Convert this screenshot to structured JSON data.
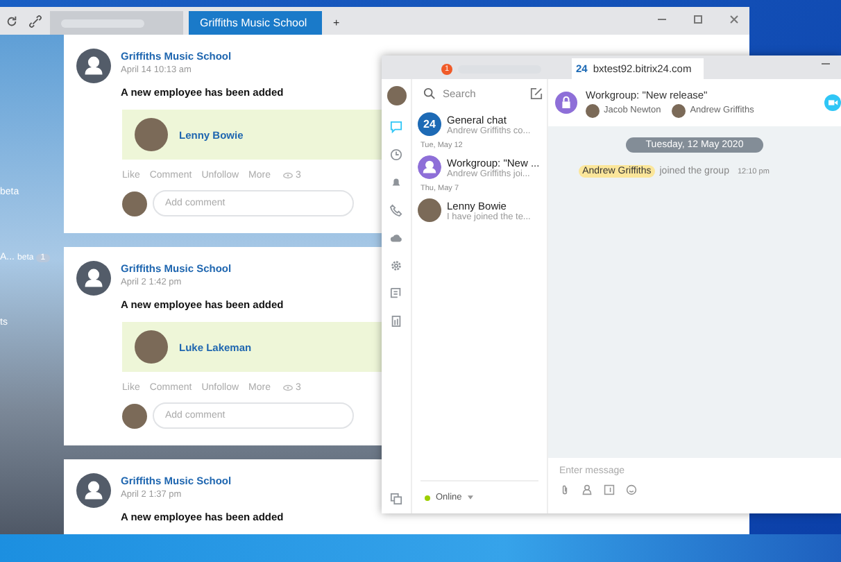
{
  "browser": {
    "tabs": [
      {
        "kind": "blurred",
        "selected": false
      },
      {
        "kind": "site",
        "label": "Griffiths Music School",
        "selected": true
      }
    ],
    "new_tab": "+"
  },
  "sidebar": {
    "items": [
      {
        "label": "beta"
      },
      {
        "label": "A...",
        "badge": "beta",
        "count": "1"
      },
      {
        "label": "ts"
      }
    ]
  },
  "posts": [
    {
      "author": "Griffiths Music School",
      "time": "April 14 10:13 am",
      "text": "A new employee has been added",
      "employee": "Lenny Bowie",
      "actions": [
        "Like",
        "Comment",
        "Unfollow",
        "More"
      ],
      "views": "3",
      "comment_placeholder": "Add comment"
    },
    {
      "author": "Griffiths Music School",
      "time": "April 2 1:42 pm",
      "text": "A new employee has been added",
      "employee": "Luke Lakeman",
      "actions": [
        "Like",
        "Comment",
        "Unfollow",
        "More"
      ],
      "views": "3",
      "comment_placeholder": "Add comment"
    },
    {
      "author": "Griffiths Music School",
      "time": "April 2 1:37 pm",
      "text": "A new employee has been added"
    }
  ],
  "messenger": {
    "tabs": [
      {
        "kind": "blurred",
        "badge": "1",
        "selected": false
      },
      {
        "kind": "site",
        "logo": "24",
        "label": "bxtest92.bitrix24.com",
        "selected": true
      }
    ],
    "rail": [
      {
        "kind": "chat",
        "selected": true
      },
      {
        "kind": "clock",
        "selected": false
      },
      {
        "kind": "bell",
        "selected": false
      },
      {
        "kind": "phone",
        "selected": false
      },
      {
        "kind": "cloud",
        "selected": false
      },
      {
        "kind": "gear",
        "selected": false
      },
      {
        "kind": "doc",
        "selected": false
      },
      {
        "kind": "bars",
        "selected": false
      }
    ],
    "search_placeholder": "Search",
    "chats": [
      {
        "kind": "general",
        "avatar_text": "24",
        "title": "General chat",
        "preview": "Andrew Griffiths co...",
        "selected": false
      },
      {
        "kind": "date",
        "label": "Tue, May 12"
      },
      {
        "kind": "group",
        "title": "Workgroup: \"New ...",
        "preview": "Andrew Griffiths joi...",
        "selected": false
      },
      {
        "kind": "date",
        "label": "Thu, May 7"
      },
      {
        "kind": "person",
        "title": "Lenny Bowie",
        "preview": "I have joined the te...",
        "selected": false
      }
    ],
    "status": "Online",
    "chat": {
      "title": "Workgroup: \"New release\"",
      "members": [
        "Jacob Newton",
        "Andrew Griffiths"
      ],
      "date": "Tuesday, 12 May 2020",
      "event": {
        "name": "Andrew Griffiths",
        "text": "joined the group",
        "time": "12:10 pm"
      },
      "input_placeholder": "Enter message"
    }
  }
}
